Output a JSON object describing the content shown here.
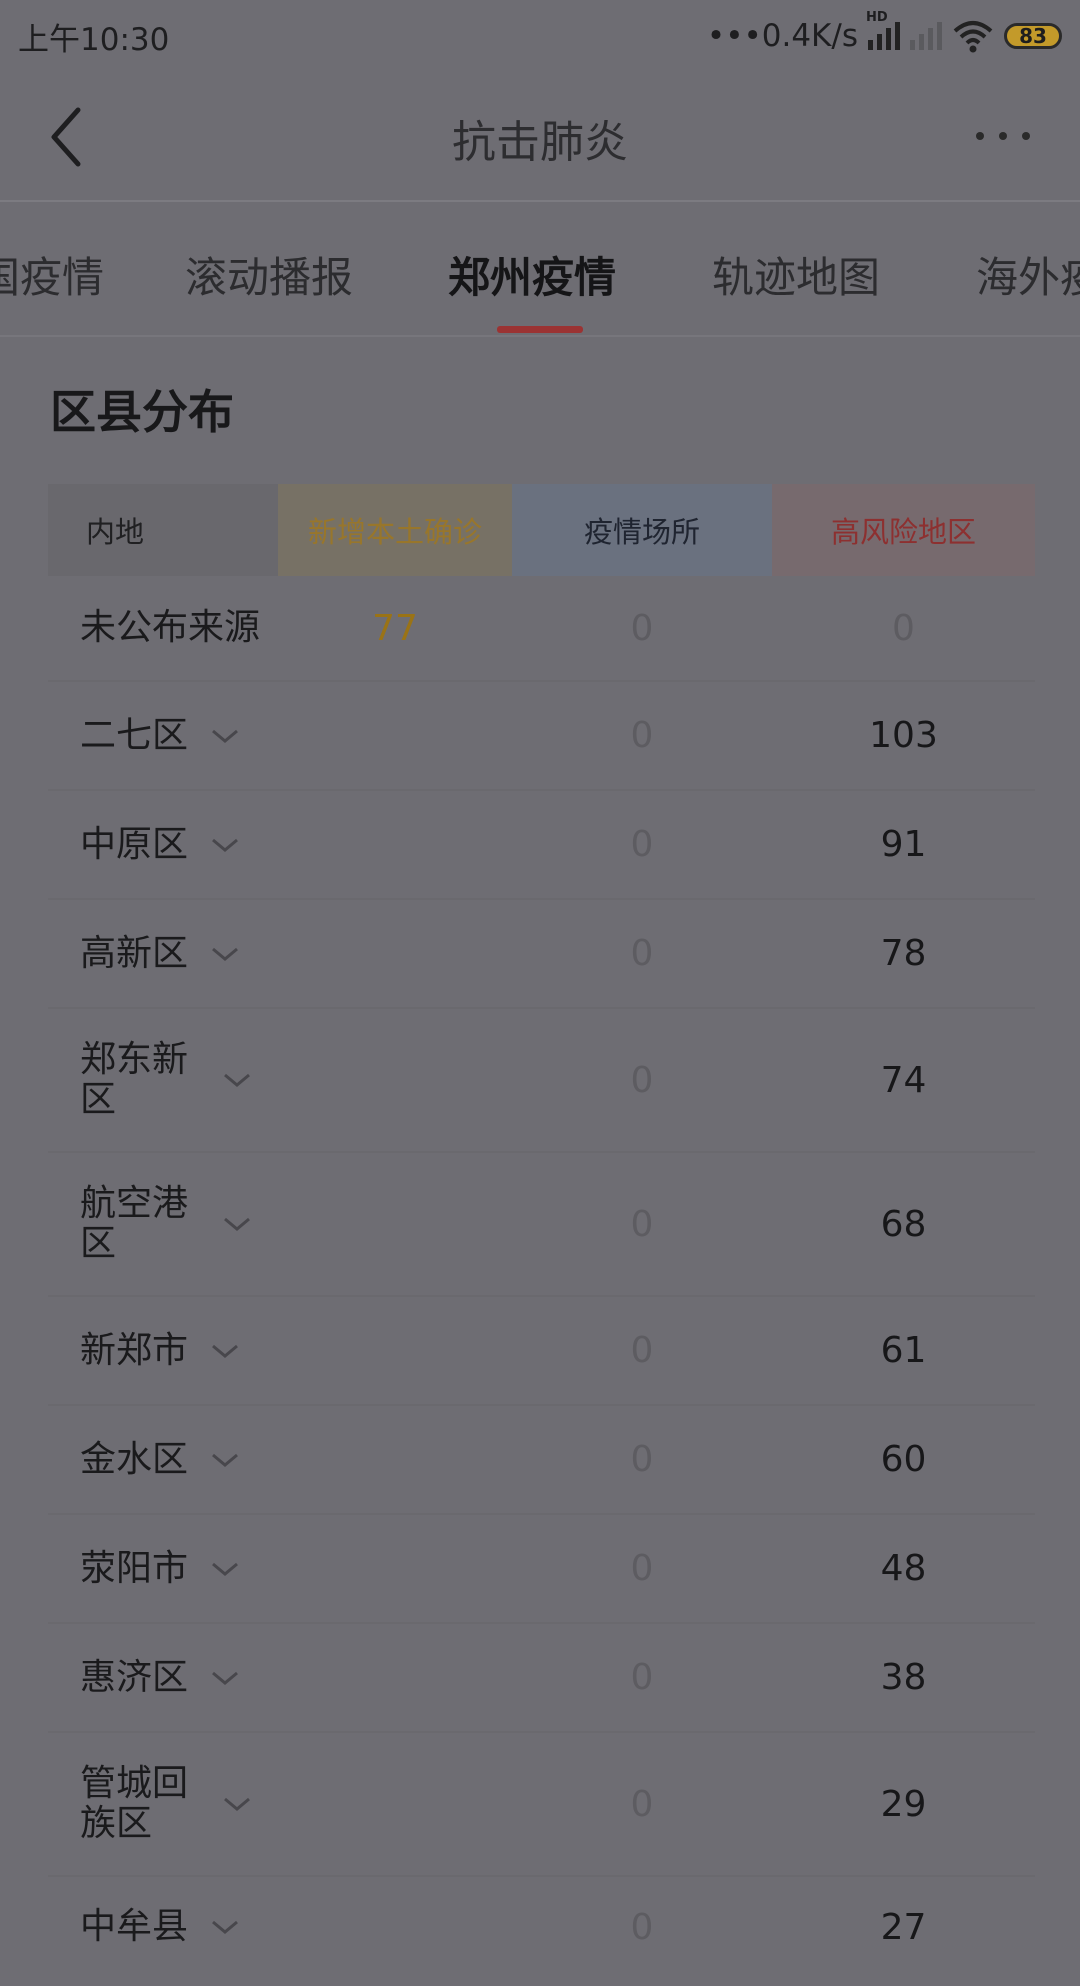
{
  "status_bar": {
    "time": "上午10:30",
    "network_speed": "•••0.4K/s",
    "hd_label": "HD",
    "battery": "83"
  },
  "header": {
    "title": "抗击肺炎"
  },
  "tabs": [
    {
      "label": "国疫情"
    },
    {
      "label": "滚动播报"
    },
    {
      "label": "郑州疫情"
    },
    {
      "label": "轨迹地图"
    },
    {
      "label": "海外疫"
    }
  ],
  "section": {
    "title": "区县分布",
    "columns": [
      "内地",
      "新增本土确诊",
      "疫情场所",
      "高风险地区"
    ],
    "rows": [
      {
        "name": "未公布来源",
        "new_local": "77",
        "sites": "0",
        "high_risk": "0",
        "expandable": false
      },
      {
        "name": "二七区",
        "new_local": "",
        "sites": "0",
        "high_risk": "103",
        "expandable": true
      },
      {
        "name": "中原区",
        "new_local": "",
        "sites": "0",
        "high_risk": "91",
        "expandable": true
      },
      {
        "name": "高新区",
        "new_local": "",
        "sites": "0",
        "high_risk": "78",
        "expandable": true
      },
      {
        "name": "郑东新区",
        "new_local": "",
        "sites": "0",
        "high_risk": "74",
        "expandable": true
      },
      {
        "name": "航空港区",
        "new_local": "",
        "sites": "0",
        "high_risk": "68",
        "expandable": true
      },
      {
        "name": "新郑市",
        "new_local": "",
        "sites": "0",
        "high_risk": "61",
        "expandable": true
      },
      {
        "name": "金水区",
        "new_local": "",
        "sites": "0",
        "high_risk": "60",
        "expandable": true
      },
      {
        "name": "荥阳市",
        "new_local": "",
        "sites": "0",
        "high_risk": "48",
        "expandable": true
      },
      {
        "name": "惠济区",
        "new_local": "",
        "sites": "0",
        "high_risk": "38",
        "expandable": true
      },
      {
        "name": "管城回族区",
        "new_local": "",
        "sites": "0",
        "high_risk": "29",
        "expandable": true
      },
      {
        "name": "中牟县",
        "new_local": "",
        "sites": "0",
        "high_risk": "27",
        "expandable": true
      }
    ]
  },
  "colors": {
    "overlay_background": "#6e6d73",
    "active_tab_indicator": "#9b3333",
    "new_local_color": "#9a7316",
    "high_risk_header_color": "#8d3030"
  }
}
